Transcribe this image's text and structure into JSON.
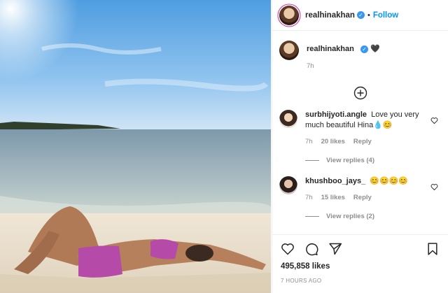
{
  "post": {
    "username": "realhinakhan",
    "follow_label": "Follow",
    "caption_emoji": "🖤",
    "caption_time": "7h",
    "likes": "495,858 likes",
    "timestamp": "7 HOURS AGO"
  },
  "comments": [
    {
      "username": "surbhijyoti.angle",
      "text": "Love you very much beautiful Hina💧😊",
      "time": "7h",
      "likes": "20 likes",
      "reply_label": "Reply",
      "view_replies": "View replies (4)"
    },
    {
      "username": "khushboo_jays_",
      "text": "😊😊😊😊",
      "time": "7h",
      "likes": "15 likes",
      "reply_label": "Reply",
      "view_replies": "View replies (2)"
    }
  ],
  "icons": {
    "verified": "verified-badge-icon",
    "heart": "heart-icon",
    "comment": "comment-icon",
    "share": "share-icon",
    "bookmark": "bookmark-icon",
    "load_more": "plus-circle-icon"
  },
  "colors": {
    "accent": "#0095f6",
    "muted": "#8e8e8e",
    "text": "#262626"
  }
}
